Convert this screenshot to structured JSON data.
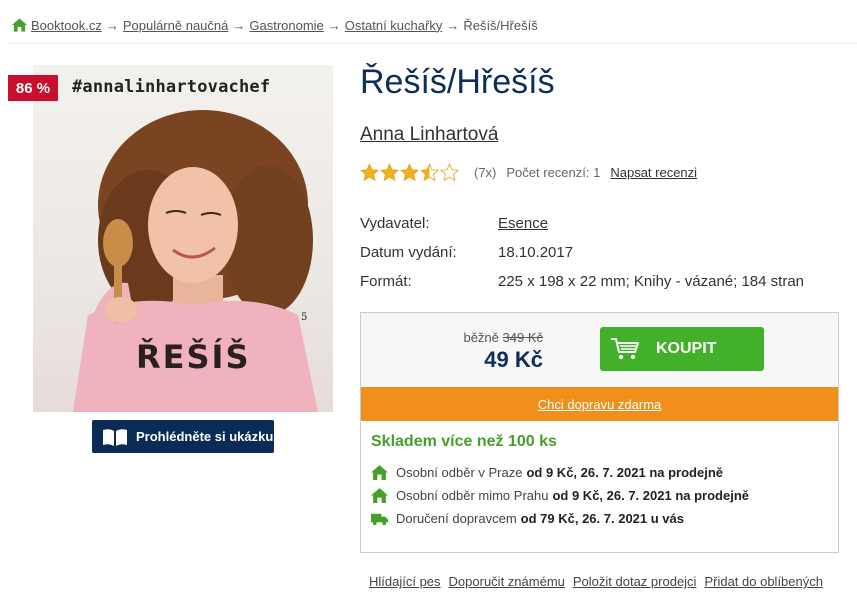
{
  "breadcrumb": {
    "items": [
      "Booktook.cz",
      "Populárně naučná",
      "Gastronomie",
      "Ostatní kuchařky"
    ],
    "current": "Řešíš/Hřešíš",
    "separator": "→"
  },
  "cover": {
    "discount": "86 %",
    "hashtag": "#annalinhartovachef",
    "shirt_text": "ŘEŠÍŠ"
  },
  "preview_button": "Prohlédněte si ukázku",
  "book": {
    "title": "Řešíš/Hřešíš",
    "author": "Anna Linhartová",
    "rating_stars": 3.5,
    "rating_max": 5,
    "rating_count": "(7x)",
    "reviews_label": "Počet recenzí: 1",
    "write_review": "Napsat recenzi"
  },
  "meta": {
    "publisher_label": "Vydavatel:",
    "publisher": "Esence",
    "date_label": "Datum vydání:",
    "date": "18.10.2017",
    "format_label": "Formát:",
    "format": "225 x 198 x 22 mm; Knihy - vázané; 184 stran"
  },
  "buy": {
    "regular_label": "běžně",
    "regular_price": "349 Kč",
    "price": "49 Kč",
    "buy_label": "KOUPIT",
    "free_shipping": "Chci dopravu zdarma",
    "stock": "Skladem více než 100 ks",
    "delivery": [
      {
        "icon": "home-icon",
        "text": "Osobní odběr v Praze",
        "detail": "od 9 Kč, 26. 7. 2021 na prodejně"
      },
      {
        "icon": "home-icon",
        "text": "Osobní odběr mimo Prahu",
        "detail": "od 9 Kč, 26. 7. 2021 na prodejně"
      },
      {
        "icon": "truck-icon",
        "text": "Doručení dopravcem",
        "detail": "od 79 Kč, 26. 7. 2021 u vás"
      }
    ]
  },
  "links": [
    "Hlídající pes",
    "Doporučit známému",
    "Položit dotaz prodejci",
    "Přidat do oblíbených"
  ],
  "colors": {
    "accent_green": "#43b02a",
    "orange": "#f28e1c",
    "navy": "#0f2d5c",
    "badge_red": "#c8102e",
    "star": "#f2b01e"
  }
}
